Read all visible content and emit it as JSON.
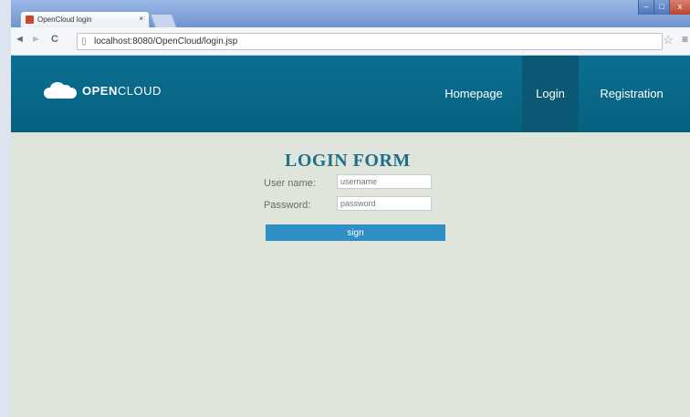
{
  "browser": {
    "tab_title": "OpenCloud login",
    "tab_close": "×",
    "url": "localhost:8080/OpenCloud/login.jsp",
    "back_icon": "◄",
    "forward_icon": "►",
    "reload_icon": "C",
    "page_icon": "▯",
    "star_icon": "☆",
    "menu_icon": "≡",
    "window_controls": {
      "minimize": "–",
      "maximize": "□",
      "close": "x"
    }
  },
  "navbar": {
    "brand_bold": "OPEN",
    "brand_light": "CLOUD",
    "links": {
      "homepage": "Homepage",
      "login": "Login",
      "registration": "Registration"
    },
    "active_link": "login",
    "color": "#0b6f92"
  },
  "form": {
    "title": "LOGIN FORM",
    "username_label": "User name:",
    "username_placeholder": "username",
    "password_label": "Password:",
    "password_placeholder": "password",
    "submit_label": "sign"
  }
}
